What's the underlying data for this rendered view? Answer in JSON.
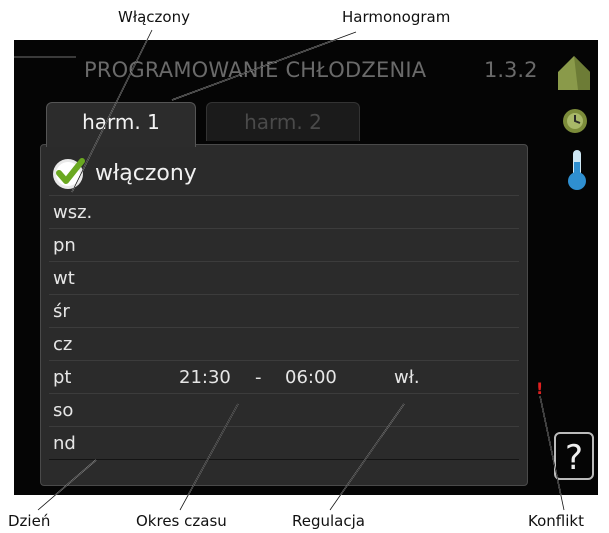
{
  "callouts": {
    "enabled": "Włączony",
    "schedule": "Harmonogram",
    "day": "Dzień",
    "time_period": "Okres czasu",
    "regulation": "Regulacja",
    "conflict": "Konflikt"
  },
  "screen": {
    "title": "PROGRAMOWANIE CHŁODZENIA",
    "menu_number": "1.3.2",
    "tabs": [
      {
        "label": "harm. 1",
        "active": true
      },
      {
        "label": "harm. 2",
        "active": false
      }
    ],
    "enabled_label": "włączony",
    "enabled_checked": true,
    "days": [
      {
        "label": "wsz.",
        "start": "",
        "end": "",
        "separator": "",
        "regulation": ""
      },
      {
        "label": "pn",
        "start": "",
        "end": "",
        "separator": "",
        "regulation": ""
      },
      {
        "label": "wt",
        "start": "",
        "end": "",
        "separator": "",
        "regulation": ""
      },
      {
        "label": "śr",
        "start": "",
        "end": "",
        "separator": "",
        "regulation": ""
      },
      {
        "label": "cz",
        "start": "",
        "end": "",
        "separator": "",
        "regulation": ""
      },
      {
        "label": "pt",
        "start": "21:30",
        "end": "06:00",
        "separator": "-",
        "regulation": "wł."
      },
      {
        "label": "so",
        "start": "",
        "end": "",
        "separator": "",
        "regulation": ""
      },
      {
        "label": "nd",
        "start": "",
        "end": "",
        "separator": "",
        "regulation": ""
      }
    ],
    "conflict_marker": "!",
    "help_symbol": "?",
    "icons": [
      "house-icon",
      "clock-icon",
      "thermometer-icon",
      "help-icon"
    ],
    "colors": {
      "background": "#050505",
      "panel": "#2b2b2b",
      "text": "#e6e6e6",
      "conflict": "#e02020",
      "check": "#6aa820"
    }
  }
}
